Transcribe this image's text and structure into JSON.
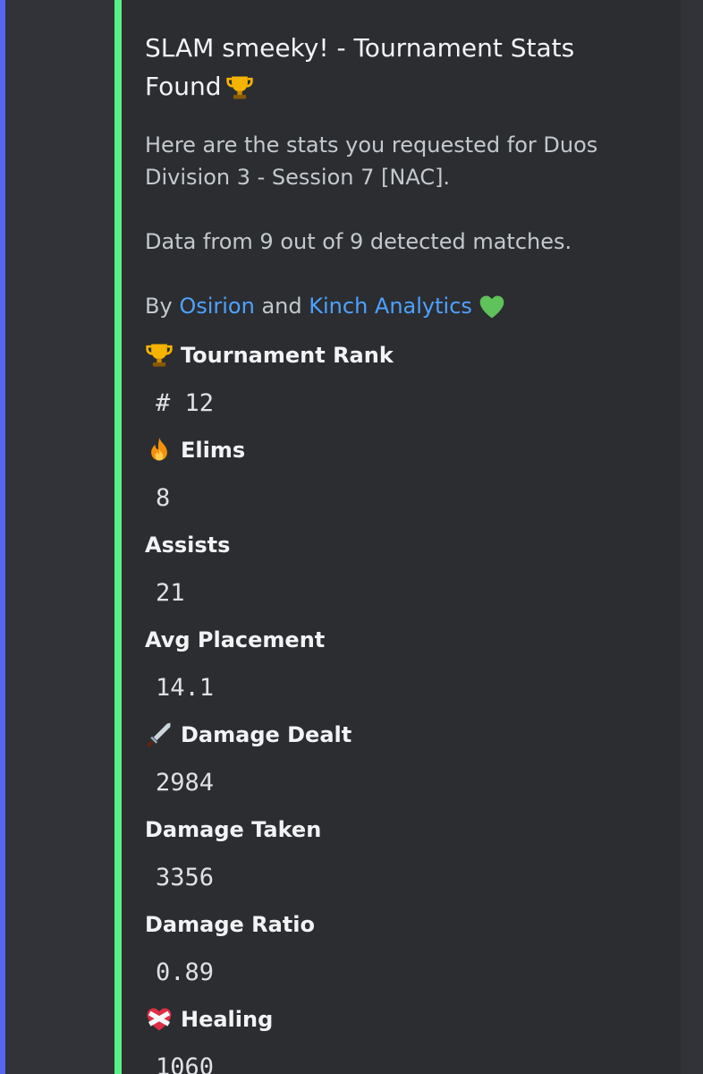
{
  "embed": {
    "title": "SLAM smeeky! - Tournament Stats Found",
    "title_emoji": "trophy-icon",
    "description_line1": "Here are the stats you requested for Duos Division 3 - Session 7 [NAC].",
    "description_line2": "Data from 9 out of 9 detected matches.",
    "credit_prefix": "By",
    "credit_link1": "Osirion",
    "credit_and": "and",
    "credit_link2": "Kinch Analytics",
    "credit_emoji": "green-heart-icon"
  },
  "fields": [
    {
      "icon": "trophy-icon",
      "name": "Tournament Rank",
      "value": "# 12"
    },
    {
      "icon": "fire-icon",
      "name": "Elims",
      "value": "8"
    },
    {
      "icon": "",
      "name": "Assists",
      "value": "21"
    },
    {
      "icon": "",
      "name": "Avg Placement",
      "value": "14.1"
    },
    {
      "icon": "dagger-icon",
      "name": "Damage Dealt",
      "value": "2984"
    },
    {
      "icon": "",
      "name": "Damage Taken",
      "value": "3356"
    },
    {
      "icon": "",
      "name": "Damage Ratio",
      "value": "0.89"
    },
    {
      "icon": "mending-heart-icon",
      "name": "Healing",
      "value": "1060"
    }
  ],
  "colors": {
    "background": "#313338",
    "embed_background": "#2b2d31",
    "embed_accent": "#57f287",
    "left_bar": "#5865f2",
    "link": "#4ea1ff"
  }
}
